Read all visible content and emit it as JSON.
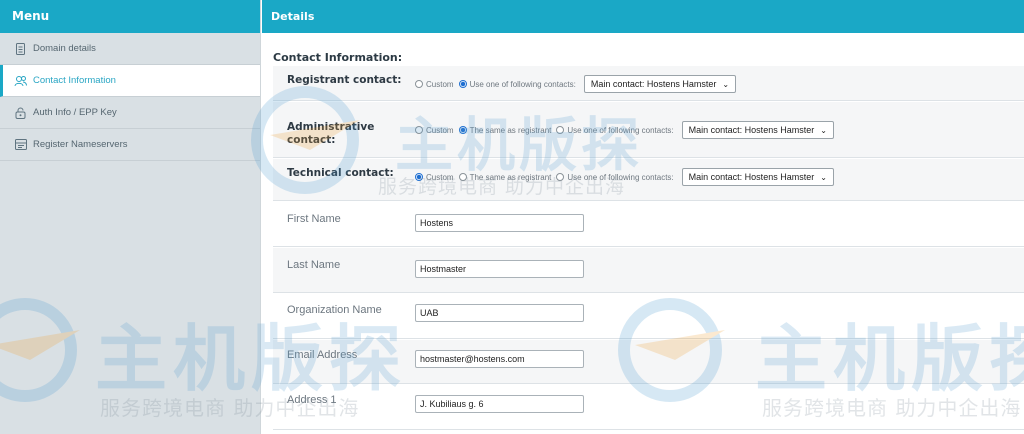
{
  "sidebar": {
    "title": "Menu",
    "items": [
      {
        "label": "Domain details",
        "icon": "document-icon"
      },
      {
        "label": "Contact Information",
        "icon": "users-icon"
      },
      {
        "label": "Auth Info / EPP Key",
        "icon": "lock-icon"
      },
      {
        "label": "Register Nameservers",
        "icon": "server-icon"
      }
    ],
    "active_index": 1
  },
  "main": {
    "title": "Details",
    "section_title": "Contact Information:",
    "registrant": {
      "label": "Registrant contact:",
      "opt_custom": "Custom",
      "opt_use": "Use one of following contacts:",
      "select_value": "Main contact: Hostens Hamster"
    },
    "administrative": {
      "label": "Administrative contact:",
      "opt_custom": "Custom",
      "opt_same": "The same as registrant",
      "opt_use": "Use one of following contacts:",
      "select_value": "Main contact: Hostens Hamster"
    },
    "technical": {
      "label": "Technical contact:",
      "opt_custom": "Custom",
      "opt_same": "The same as registrant",
      "opt_use": "Use one of following contacts:",
      "select_value": "Main contact: Hostens Hamster"
    },
    "fields": [
      {
        "label": "First Name",
        "value": "Hostens"
      },
      {
        "label": "Last Name",
        "value": "Hostmaster"
      },
      {
        "label": "Organization Name",
        "value": "UAB"
      },
      {
        "label": "Email Address",
        "value": "hostmaster@hostens.com"
      },
      {
        "label": "Address 1",
        "value": "J. Kubiliaus g. 6"
      }
    ]
  },
  "watermark": {
    "brand": "主机版探",
    "slogan": "服务跨境电商 助力中企出海"
  },
  "colors": {
    "header_bg": "#1aa8c6",
    "sidebar_bg": "#d9e0e4",
    "active_text": "#2aa6c4"
  }
}
